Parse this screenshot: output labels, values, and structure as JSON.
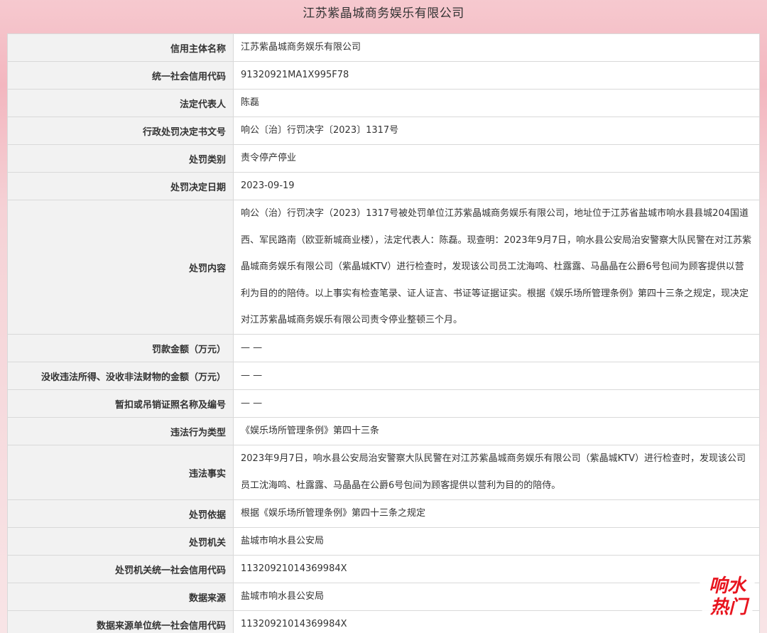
{
  "title": "江苏紫晶城商务娱乐有限公司",
  "rows": [
    {
      "label": "信用主体名称",
      "value": "江苏紫晶城商务娱乐有限公司"
    },
    {
      "label": "统一社会信用代码",
      "value": "91320921MA1X995F78"
    },
    {
      "label": "法定代表人",
      "value": "陈磊"
    },
    {
      "label": "行政处罚决定书文号",
      "value": "响公〔治〕行罚决字〔2023〕1317号"
    },
    {
      "label": "处罚类别",
      "value": "责令停产停业"
    },
    {
      "label": "处罚决定日期",
      "value": "2023-09-19"
    },
    {
      "label": "处罚内容",
      "value": "响公（治）行罚决字（2023）1317号被处罚单位江苏紫晶城商务娱乐有限公司，地址位于江苏省盐城市响水县县城204国道西、军民路南（欧亚新城商业楼），法定代表人：陈磊。现查明：2023年9月7日，响水县公安局治安警察大队民警在对江苏紫晶城商务娱乐有限公司（紫晶城KTV）进行检查时，发现该公司员工沈海鸣、杜露露、马晶晶在公爵6号包间为顾客提供以营利为目的的陪侍。以上事实有检查笔录、证人证言、书证等证据证实。根据《娱乐场所管理条例》第四十三条之规定，现决定对江苏紫晶城商务娱乐有限公司责令停业整顿三个月。"
    },
    {
      "label": "罚款金额（万元）",
      "value": "— —"
    },
    {
      "label": "没收违法所得、没收非法财物的金额（万元）",
      "value": "— —"
    },
    {
      "label": "暂扣或吊销证照名称及编号",
      "value": "— —"
    },
    {
      "label": "违法行为类型",
      "value": "《娱乐场所管理条例》第四十三条"
    },
    {
      "label": "违法事实",
      "value": "2023年9月7日，响水县公安局治安警察大队民警在对江苏紫晶城商务娱乐有限公司（紫晶城KTV）进行检查时，发现该公司员工沈海鸣、杜露露、马晶晶在公爵6号包间为顾客提供以营利为目的的陪侍。"
    },
    {
      "label": "处罚依据",
      "value": "根据《娱乐场所管理条例》第四十三条之规定"
    },
    {
      "label": "处罚机关",
      "value": "盐城市响水县公安局"
    },
    {
      "label": "处罚机关统一社会信用代码",
      "value": "11320921014369984X"
    },
    {
      "label": "数据来源",
      "value": "盐城市响水县公安局"
    },
    {
      "label": "数据来源单位统一社会信用代码",
      "value": "11320921014369984X"
    }
  ],
  "badge": {
    "line1": "响水",
    "line2": "热门",
    "color": "#e8141e"
  }
}
